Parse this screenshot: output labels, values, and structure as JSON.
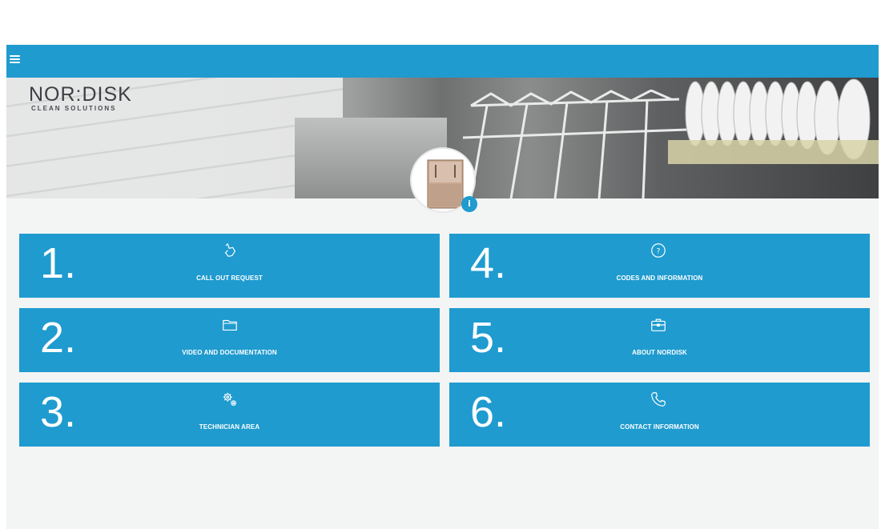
{
  "header": {
    "menu_icon": "hamburger-menu-icon",
    "accent_color": "#1f9bcf"
  },
  "brand": {
    "logo_main": "NOR:DISK",
    "logo_sub": "CLEAN SOLUTIONS"
  },
  "hero": {
    "info_label": "i"
  },
  "menu": {
    "tiles": [
      {
        "number": "1.",
        "label": "CALL OUT REQUEST",
        "icon": "hand-pointer-icon"
      },
      {
        "number": "2.",
        "label": "VIDEO AND DOCUMENTATION",
        "icon": "folder-icon"
      },
      {
        "number": "3.",
        "label": "TECHNICIAN AREA",
        "icon": "gears-icon"
      },
      {
        "number": "4.",
        "label": "CODES AND INFORMATION",
        "icon": "question-circle-icon"
      },
      {
        "number": "5.",
        "label": "ABOUT NORDISK",
        "icon": "briefcase-icon"
      },
      {
        "number": "6.",
        "label": "CONTACT INFORMATION",
        "icon": "phone-icon"
      }
    ]
  }
}
